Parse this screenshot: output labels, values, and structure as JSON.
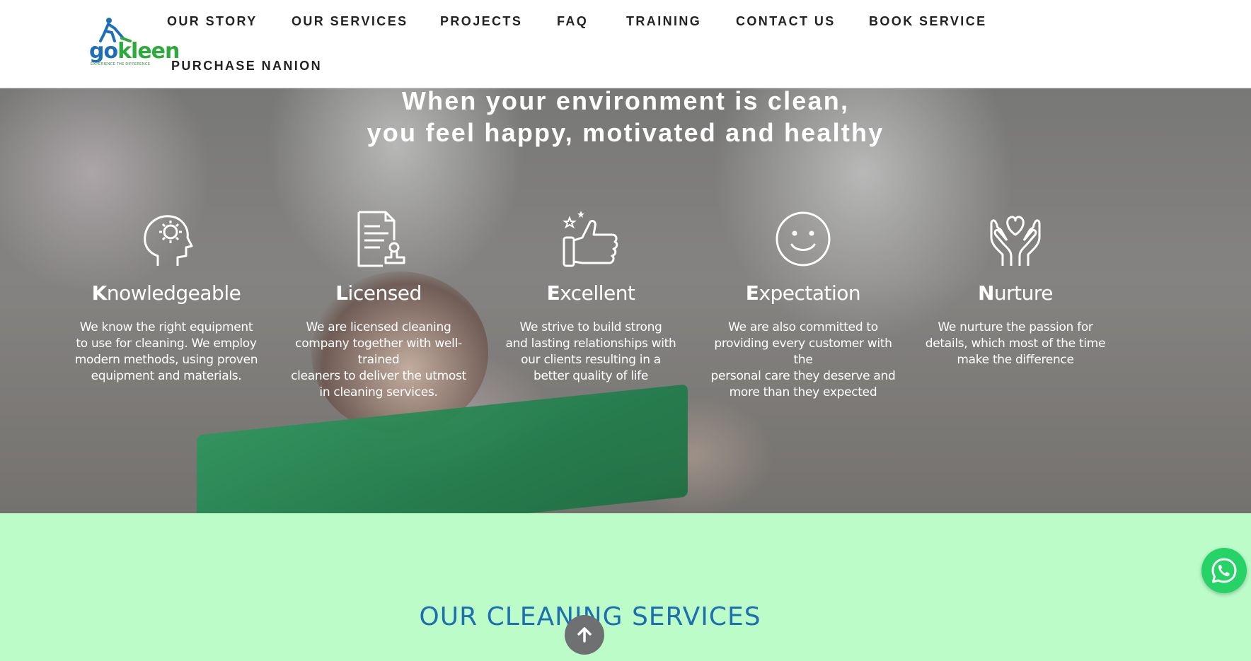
{
  "brand": {
    "logo_text_go": "go",
    "logo_text_kleen": "kleen",
    "tagline": "EXPERIENCE THE DIFFERENCE"
  },
  "nav": {
    "items": [
      "OUR STORY",
      "OUR SERVICES",
      "PROJECTS",
      "FAQ",
      "TRAINING",
      "CONTACT US",
      "BOOK SERVICE",
      "PURCHASE NANION"
    ]
  },
  "hero": {
    "headline_line1": "When your environment is clean,",
    "headline_line2": "you feel happy, motivated and healthy",
    "features": [
      {
        "icon": "head-gear-icon",
        "cap": "K",
        "rest": "nowledgeable",
        "desc": "We know the right equipment\nto use for cleaning. We employ\nmodern methods, using proven\nequipment and materials."
      },
      {
        "icon": "certificate-stamp-icon",
        "cap": "L",
        "rest": "icensed",
        "desc": "We are licensed cleaning\ncompany together with well-trained\ncleaners to deliver the utmost\nin cleaning services."
      },
      {
        "icon": "thumbs-up-stars-icon",
        "cap": "E",
        "rest": "xcellent",
        "desc": "We strive to build strong\nand lasting relationships with\nour clients resulting in a\nbetter quality of life"
      },
      {
        "icon": "smiley-face-icon",
        "cap": "E",
        "rest": "xpectation",
        "desc": "We are also committed to\nproviding every customer with the\npersonal care they deserve and\nmore than they expected"
      },
      {
        "icon": "hands-heart-icon",
        "cap": "N",
        "rest": "urture",
        "desc": "We nurture the passion for\ndetails, which most of the time\nmake the difference"
      }
    ]
  },
  "services": {
    "heading": "OUR CLEANING SERVICES"
  },
  "colors": {
    "services_band": "#bbfcc8",
    "heading_blue": "#1d6fb0",
    "whatsapp_green": "#25d366",
    "logo_blue": "#1e6fb8",
    "logo_green": "#2eaa3c"
  },
  "floating": {
    "scroll_top_icon": "arrow-up-icon",
    "chat_icon": "whatsapp-icon"
  }
}
